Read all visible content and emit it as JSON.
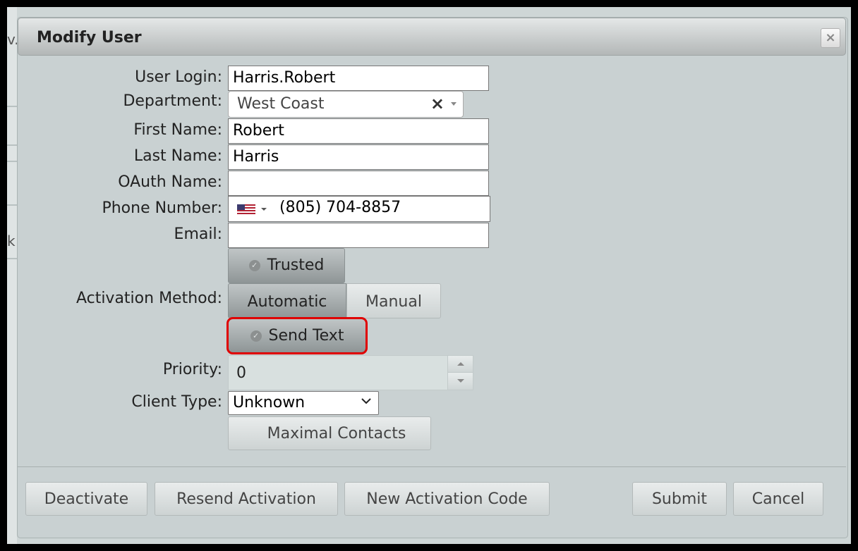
{
  "dialog": {
    "title": "Modify User",
    "close_icon": "close-icon"
  },
  "background": {
    "edge_text_top": "v.",
    "edge_text_bottom": "k"
  },
  "form": {
    "user_login_label": "User Login:",
    "user_login_value": "Harris.Robert",
    "department_label": "Department:",
    "department_value": "West Coast",
    "first_name_label": "First Name:",
    "first_name_value": "Robert",
    "last_name_label": "Last Name:",
    "last_name_value": "Harris",
    "oauth_name_label": "OAuth Name:",
    "oauth_name_value": "",
    "phone_label": "Phone Number:",
    "phone_value": "(805) 704-8857",
    "phone_country_icon": "us-flag-icon",
    "email_label": "Email:",
    "email_value": "",
    "trusted_label": "Trusted",
    "activation_method_label": "Activation Method:",
    "activation_automatic": "Automatic",
    "activation_manual": "Manual",
    "send_text_label": "Send Text",
    "priority_label": "Priority:",
    "priority_value": "0",
    "client_type_label": "Client Type:",
    "client_type_value": "Unknown",
    "maximal_contacts_label": "Maximal Contacts"
  },
  "footer": {
    "deactivate": "Deactivate",
    "resend_activation": "Resend Activation",
    "new_activation_code": "New Activation Code",
    "submit": "Submit",
    "cancel": "Cancel"
  },
  "colors": {
    "highlight": "#e00000",
    "dialog_bg": "#c9d1d2",
    "active_button": "#8f9697"
  }
}
